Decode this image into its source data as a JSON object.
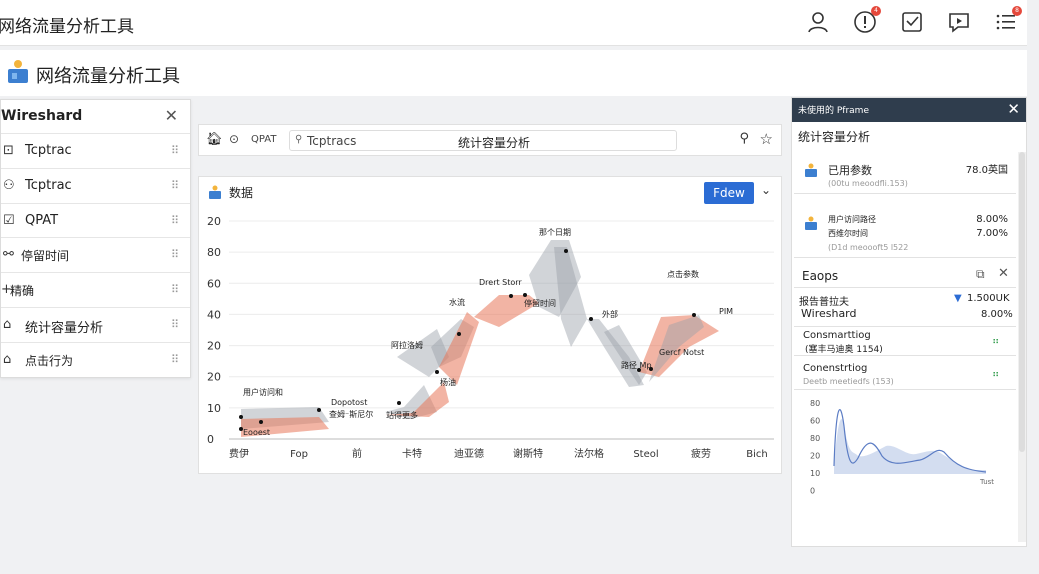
{
  "window": {
    "title": "网络流量分析工具"
  },
  "app": {
    "name": "网络流量分析工具"
  },
  "top_icons": [
    {
      "name": "user-icon"
    },
    {
      "name": "alert-icon",
      "badge": "4"
    },
    {
      "name": "check-box-icon"
    },
    {
      "name": "chat-icon"
    },
    {
      "name": "list-icon",
      "badge": "8"
    }
  ],
  "sidebar": {
    "title": "Wireshard",
    "close": "✕",
    "items": [
      {
        "icon": "⊡",
        "label": "Tcptrac"
      },
      {
        "icon": "⚇",
        "label": "Tcptrac"
      },
      {
        "icon": "☑",
        "label": "QPAT"
      },
      {
        "icon": "⚯",
        "label": "停留时间"
      },
      {
        "icon": "+",
        "label": "精确"
      },
      {
        "icon": "⌂",
        "label": "统计容量分析"
      },
      {
        "icon": "⌂",
        "label": "点击行为"
      }
    ]
  },
  "toolbar": {
    "qpat": "QPAT",
    "search_value": "Tcptracs",
    "center_label": "统计容量分析"
  },
  "chart_card": {
    "title": "数据",
    "button": "Fdew"
  },
  "chart_data": {
    "type": "area",
    "y_ticks": [
      "20",
      "80",
      "60",
      "40",
      "20",
      "20",
      "10",
      "0"
    ],
    "x_ticks": [
      "费伊",
      "Fop",
      "前",
      "卡特",
      "迪亚德",
      "谢斯特",
      "法尔格",
      "Steol",
      "疲劳",
      "Bich"
    ],
    "series_color_primary": "#e8775a",
    "series_color_secondary": "#9aa0a8",
    "annotations": [
      "用户访问和",
      "Eooest",
      "Dopotost",
      "查姆⁻斯尼尔",
      "站得更多",
      "阿拉洛姆",
      "水流",
      "杨油",
      "Drert Storr",
      "停留时间",
      "那个日期",
      "外部",
      "路径 Mp",
      "Gercf Notst",
      "点击参数",
      "PIM"
    ]
  },
  "right_panel": {
    "dark_title": "未使用的 Pframe",
    "subtitle": "统计容量分析",
    "card1": {
      "title": "已用参数",
      "value": "78.0英国",
      "sub": "(00tu meoodfli.153)"
    },
    "card2": {
      "row1_label": "用户访问路径",
      "row1_value": "8.00%",
      "row2_label": "西维尔时间",
      "row2_value": "7.00%",
      "sub": "(D1d meoooft5 l522"
    },
    "section": {
      "title": "Eaops"
    },
    "report": {
      "label": "报告普拉夫",
      "value": "1.500UK",
      "name": "Wireshard",
      "pct": "8.00%"
    },
    "conn1": {
      "title": "Consmarttiog",
      "sub": "(塞丰马迪奥 1154)"
    },
    "conn2": {
      "title": "Conenstrtiog",
      "sub": "Deetb meetiedfs (153)"
    },
    "mini_chart": {
      "y_ticks": [
        "80",
        "60",
        "80",
        "20",
        "10",
        "0"
      ],
      "x_label": "Tust"
    }
  }
}
